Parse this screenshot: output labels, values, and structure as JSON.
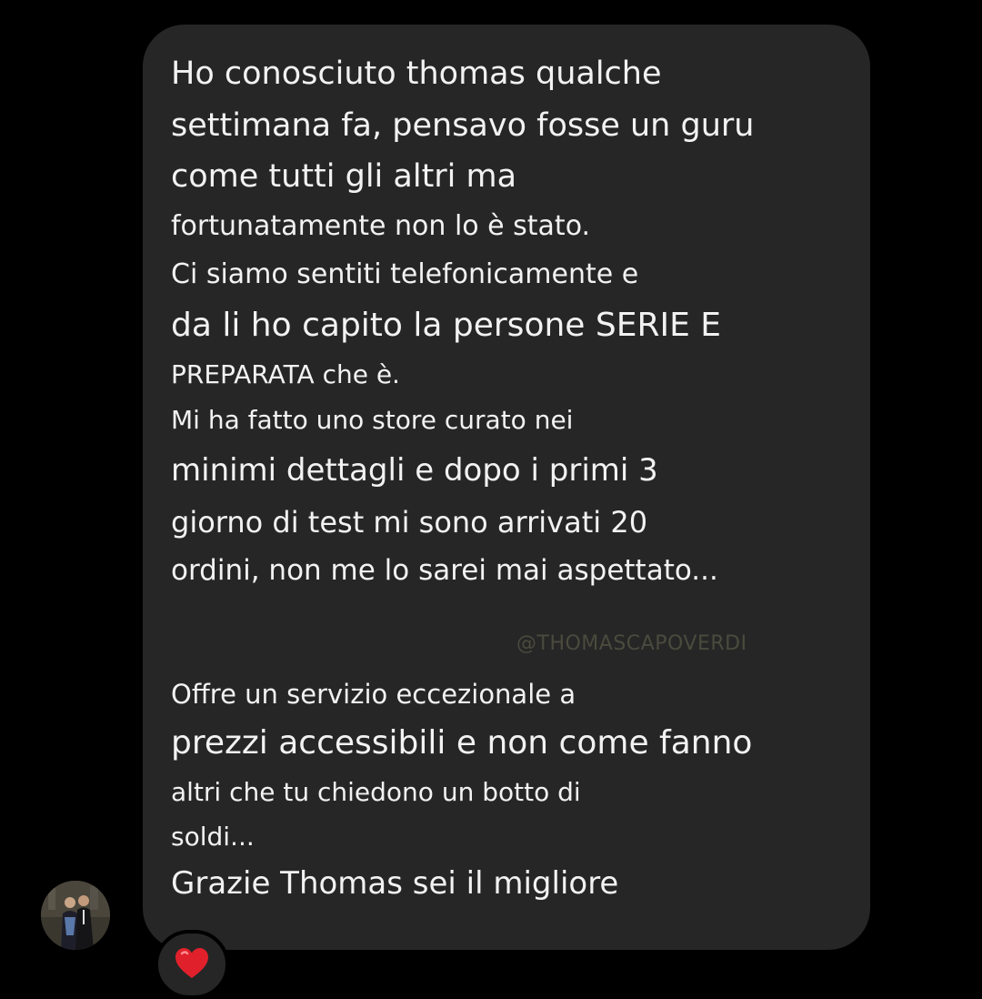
{
  "message": {
    "lines": [
      "Ho conosciuto thomas qualche",
      "settimana fa, pensavo fosse un guru",
      "come tutti gli altri ma",
      "fortunatamente non lo è stato.",
      "Ci siamo sentiti telefonicamente e",
      "da li ho capito la persone SERIE E",
      "PREPARATA che è.",
      "Mi ha fatto uno store curato nei",
      "minimi dettagli e dopo i primi 3",
      "giorno di test mi sono arrivati 20",
      "ordini, non me lo sarei mai  aspettato...",
      "Offre un servizio eccezionale a",
      "prezzi accessibili e non come fanno",
      "altri che tu chiedono un botto di",
      "soldi...",
      "Grazie Thomas sei il migliore"
    ]
  },
  "watermark": "@THOMASCAPOVERDI",
  "reaction": {
    "icon": "red-heart-icon",
    "color": "#e0212b"
  },
  "colors": {
    "background": "#000000",
    "bubble": "#262626",
    "text": "#f2f2f2",
    "watermark": "#4a4a3e"
  }
}
